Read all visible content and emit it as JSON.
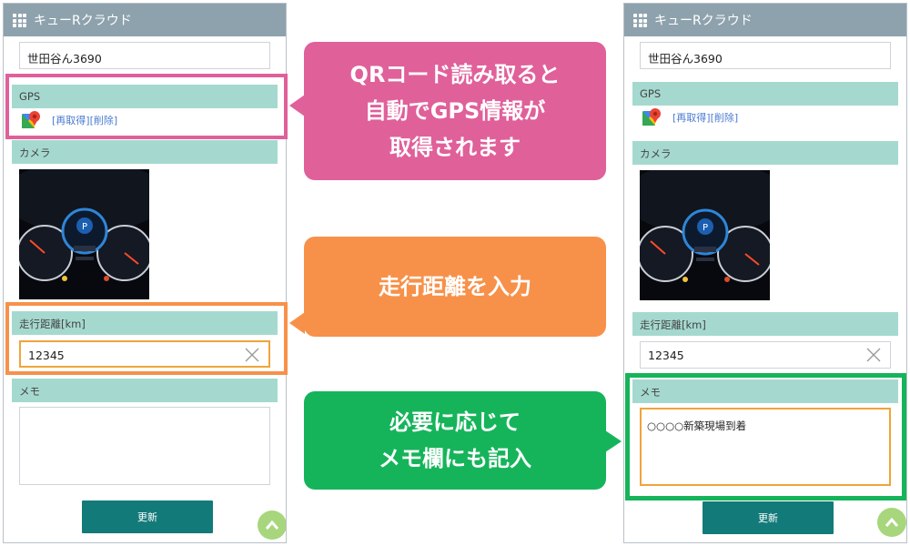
{
  "app": {
    "title": "キューRクラウド"
  },
  "left_screen": {
    "address_value": "世田谷ん3690",
    "gps_label": "GPS",
    "gps_links": "[再取得][削除]",
    "camera_label": "カメラ",
    "mileage_label": "走行距離[km]",
    "mileage_value": "12345",
    "memo_label": "メモ",
    "memo_value": "",
    "update_button": "更新"
  },
  "right_screen": {
    "address_value": "世田谷ん3690",
    "gps_label": "GPS",
    "gps_links": "[再取得][削除]",
    "camera_label": "カメラ",
    "mileage_label": "走行距離[km]",
    "mileage_value": "12345",
    "memo_label": "メモ",
    "memo_value": "○○○○新築現場到着",
    "update_button": "更新"
  },
  "callouts": {
    "gps": "QRコード読み取ると\n自動でGPS情報が\n取得されます",
    "mileage": "走行距離を入力",
    "memo": "必要に応じて\nメモ欄にも記入"
  },
  "colors": {
    "app_bar": "#8ea2ad",
    "section_header": "#a5d9cf",
    "button": "#137a7a",
    "callout_pink": "#e0609a",
    "callout_orange": "#f7914a",
    "callout_green": "#16b45a",
    "input_focus": "#f0a43a"
  },
  "icons": [
    "grid-icon",
    "google-maps-icon",
    "clear-icon",
    "chevron-up-icon"
  ]
}
